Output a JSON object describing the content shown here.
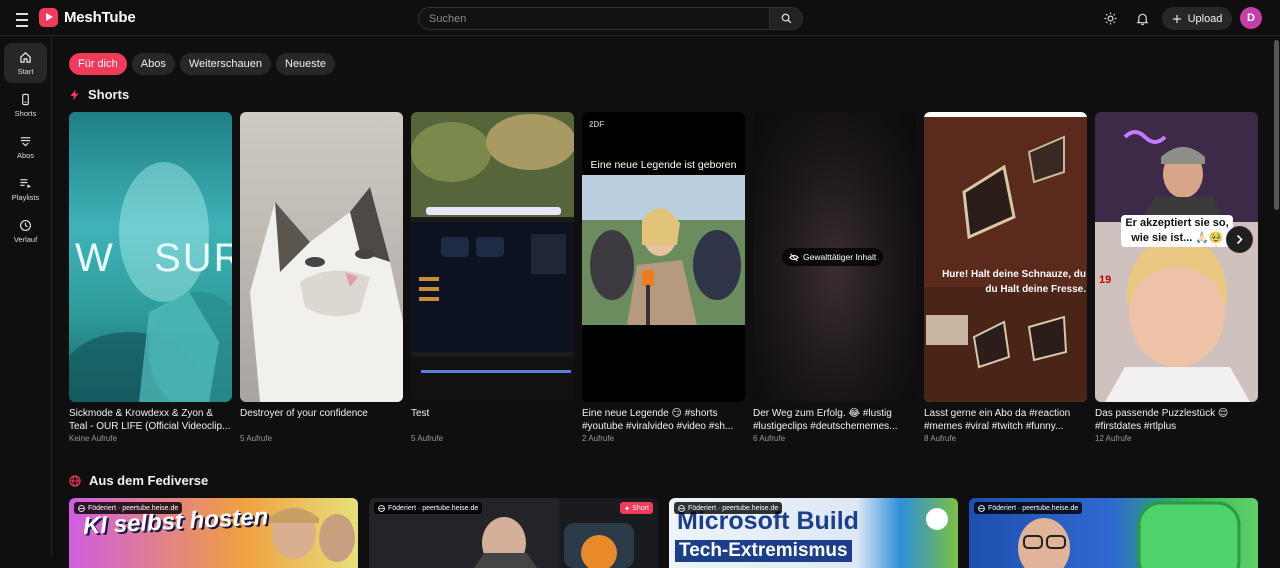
{
  "header": {
    "app_name": "MeshTube",
    "search_placeholder": "Suchen",
    "upload_label": "Upload",
    "avatar_letter": "D"
  },
  "sidebar": {
    "items": [
      {
        "label": "Start",
        "icon": "home-icon",
        "active": true
      },
      {
        "label": "Shorts",
        "icon": "shorts-icon"
      },
      {
        "label": "Abos",
        "icon": "subscriptions-icon"
      },
      {
        "label": "Playlists",
        "icon": "playlists-icon"
      },
      {
        "label": "Verlauf",
        "icon": "history-icon"
      }
    ]
  },
  "chips": [
    {
      "label": "Für dich",
      "active": true
    },
    {
      "label": "Abos"
    },
    {
      "label": "Weiterschauen"
    },
    {
      "label": "Neueste"
    }
  ],
  "shorts_section": {
    "title": "Shorts",
    "items": [
      {
        "title": "Sickmode & Krowdexx & Zyon & Teal - OUR LIFE (Official Videoclip...",
        "views": "Keine Aufrufe",
        "overlay": "W   SURV"
      },
      {
        "title": "Destroyer of your confidence",
        "views": "5 Aufrufe"
      },
      {
        "title": "Test",
        "views": "5 Aufrufe"
      },
      {
        "title": "Eine neue Legende 😏 #shorts #youtube #viralvideo #video #sh...",
        "views": "2 Aufrufe",
        "overlay": "Eine neue Legende ist geboren",
        "logo": "2DF"
      },
      {
        "title": "Der Weg zum Erfolg. 😂 #lustig #lustigeclips #deutschememes...",
        "views": "6 Aufrufe",
        "overlay": "Gewalttätiger Inhalt"
      },
      {
        "title": "Lasst gerne ein Abo da #reaction #memes #viral #twitch #funny...",
        "views": "8 Aufrufe",
        "overlay": "Hure! Halt deine Schnauze, du du Halt deine Fresse."
      },
      {
        "title": "Das passende Puzzlestück 😌 #firstdates #rtlplus",
        "views": "12 Aufrufe",
        "overlay": "Er akzeptiert sie so, wie sie ist... 🙏🏻🥹",
        "number": "19"
      }
    ]
  },
  "fediverse_section": {
    "title": "Aus dem Fediverse",
    "items": [
      {
        "badge": "Föderiert · peertube.heise.de",
        "thumb_text": "KI selbst hosten"
      },
      {
        "badge": "Föderiert · peertube.heise.de",
        "short_badge": "Short"
      },
      {
        "badge": "Föderiert · peertube.heise.de",
        "thumb_text": "Microsoft Build",
        "thumb_text2": "Tech-Extremismus"
      },
      {
        "badge": "Föderiert · peertube.heise.de"
      }
    ]
  },
  "colors": {
    "accent": "#f23b5a",
    "background": "#0f0f0f"
  }
}
